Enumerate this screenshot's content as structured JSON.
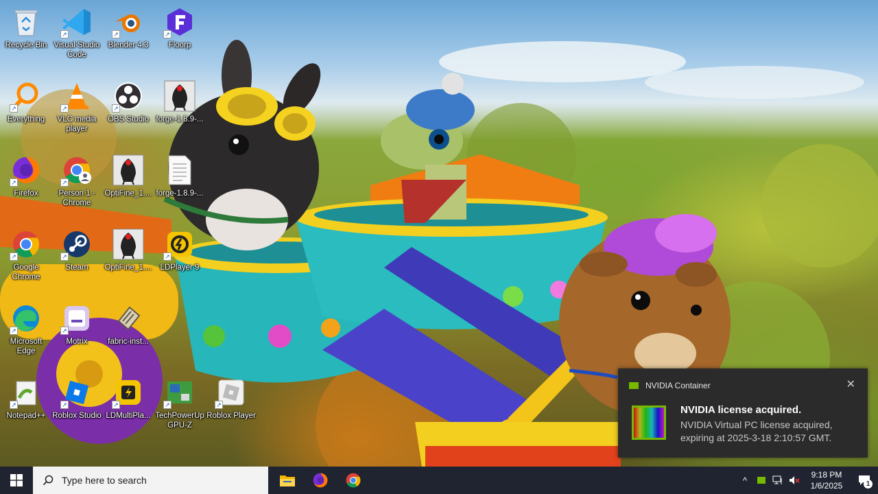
{
  "desktop": {
    "icons": [
      {
        "label": "Recycle Bin",
        "icon": "recycle-bin-icon"
      },
      {
        "label": "Visual Studio Code",
        "icon": "vscode-icon"
      },
      {
        "label": "Blender 4.3",
        "icon": "blender-icon"
      },
      {
        "label": "Floorp",
        "icon": "floorp-icon"
      },
      {
        "label": "Everything",
        "icon": "everything-icon"
      },
      {
        "label": "VLC media player",
        "icon": "vlc-icon"
      },
      {
        "label": "OBS Studio",
        "icon": "obs-icon"
      },
      {
        "label": "forge-1.8.9-...",
        "icon": "java-icon"
      },
      {
        "label": "Firefox",
        "icon": "firefox-icon"
      },
      {
        "label": "Person 1 - Chrome",
        "icon": "chrome-profile-icon"
      },
      {
        "label": "OptiFine_1....",
        "icon": "java-icon"
      },
      {
        "label": "forge-1.8.9-...",
        "icon": "document-icon"
      },
      {
        "label": "Google Chrome",
        "icon": "chrome-icon"
      },
      {
        "label": "Steam",
        "icon": "steam-icon"
      },
      {
        "label": "OptiFine_1....",
        "icon": "java-icon"
      },
      {
        "label": "LDPlayer 9",
        "icon": "ldplayer-icon"
      },
      {
        "label": "Microsoft Edge",
        "icon": "edge-icon"
      },
      {
        "label": "Motrix",
        "icon": "motrix-icon"
      },
      {
        "label": "fabric-inst...",
        "icon": "fabric-icon"
      },
      {
        "label": "Notepad++",
        "icon": "notepadpp-icon"
      },
      {
        "label": "Roblox Studio",
        "icon": "roblox-studio-icon"
      },
      {
        "label": "LDMultiPla...",
        "icon": "ldmultiplayer-icon"
      },
      {
        "label": "TechPowerUp GPU-Z",
        "icon": "gpuz-icon"
      },
      {
        "label": "Roblox Player",
        "icon": "roblox-player-icon"
      }
    ]
  },
  "notification": {
    "app_name": "NVIDIA Container",
    "title": "NVIDIA license acquired.",
    "body": "NVIDIA Virtual PC license acquired, expiring at 2025-3-18 2:10:57 GMT.",
    "close_glyph": "✕",
    "accent": "#76b900"
  },
  "taskbar": {
    "search_placeholder": "Type here to search",
    "pinned": [
      "file-explorer-icon",
      "firefox-icon",
      "chrome-icon"
    ],
    "tray": {
      "chevron": "^",
      "time": "9:18 PM",
      "date": "1/6/2025",
      "notification_count": "1"
    }
  },
  "colors": {
    "taskbar_bg": "#1f2430",
    "search_bg": "#f3f3f3",
    "toast_bg": "#2b2b2b"
  }
}
